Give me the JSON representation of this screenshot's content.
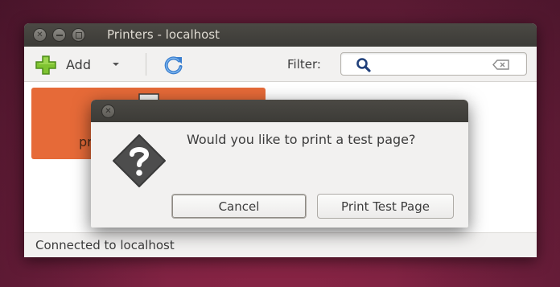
{
  "window": {
    "title": "Printers - localhost",
    "controls": [
      "close",
      "minimize",
      "maximize"
    ]
  },
  "toolbar": {
    "add_label": "Add",
    "add_icon": "plus-icon",
    "dropdown_icon": "chevron-down-icon",
    "refresh_icon": "refresh-icon",
    "filter_label": "Filter:",
    "filter_value": "",
    "search_icon": "search-icon",
    "clear_icon": "clear-icon"
  },
  "printers": [
    {
      "name_partial": "pr",
      "icon": "printer-icon",
      "selected": true,
      "tile_color": "#e66a38"
    }
  ],
  "status": {
    "text": "Connected to localhost"
  },
  "dialog": {
    "icon": "question-icon",
    "message": "Would you like to print a test page?",
    "buttons": {
      "cancel": "Cancel",
      "print": "Print Test Page"
    }
  },
  "colors": {
    "titlebar": "#3c3b37",
    "window_bg": "#f2f1f0",
    "accent_orange": "#e66a38",
    "desktop": "#6d1f3c"
  }
}
